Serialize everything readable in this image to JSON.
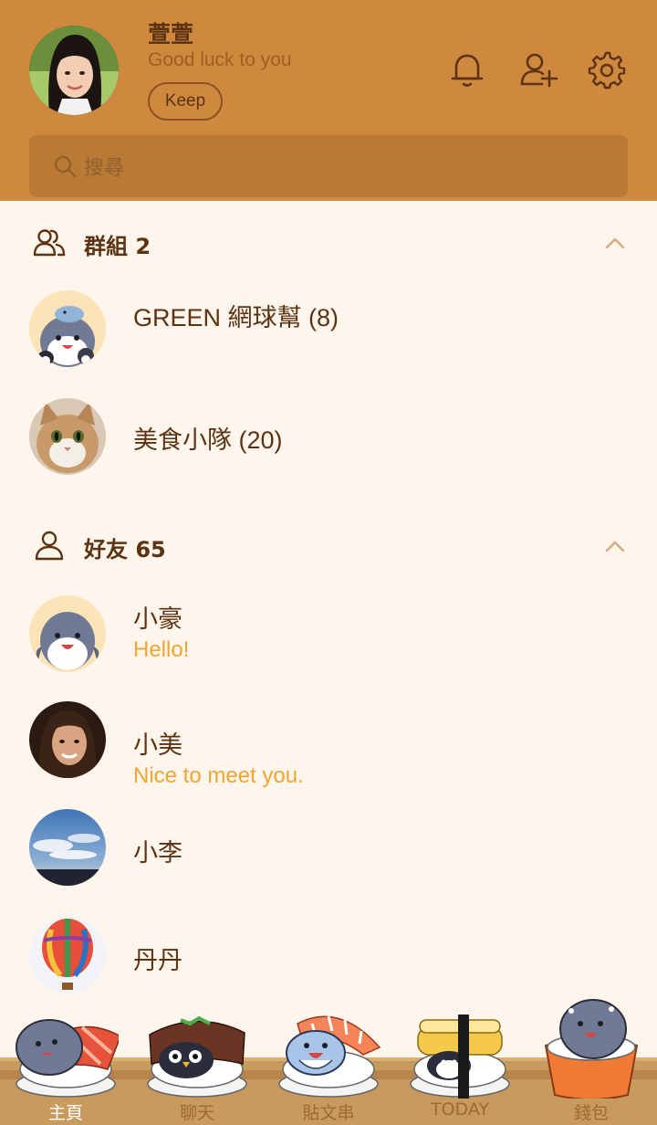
{
  "profile": {
    "name": "萱萱",
    "status": "Good luck to you",
    "keep_label": "Keep"
  },
  "header_icons": [
    "bell-icon",
    "add-friend-icon",
    "settings-gear-icon"
  ],
  "search": {
    "placeholder": "搜尋"
  },
  "groups": {
    "title": "群組 2",
    "items": [
      {
        "name": "GREEN 網球幫 (8)"
      },
      {
        "name": "美食小隊 (20)"
      }
    ]
  },
  "friends": {
    "title": "好友 65",
    "items": [
      {
        "name": "小豪",
        "message": "Hello!"
      },
      {
        "name": "小美",
        "message": "Nice to meet you."
      },
      {
        "name": "小李",
        "message": ""
      },
      {
        "name": "丹丹",
        "message": ""
      }
    ]
  },
  "bottom_nav": {
    "items": [
      {
        "label": "主頁"
      },
      {
        "label": "聊天"
      },
      {
        "label": "貼文串"
      },
      {
        "label": "TODAY"
      },
      {
        "label": "錢包"
      }
    ]
  },
  "colors": {
    "header": "#cf893f",
    "background": "#fef6ed",
    "text": "#5c3312",
    "accent_message": "#f0a531"
  }
}
